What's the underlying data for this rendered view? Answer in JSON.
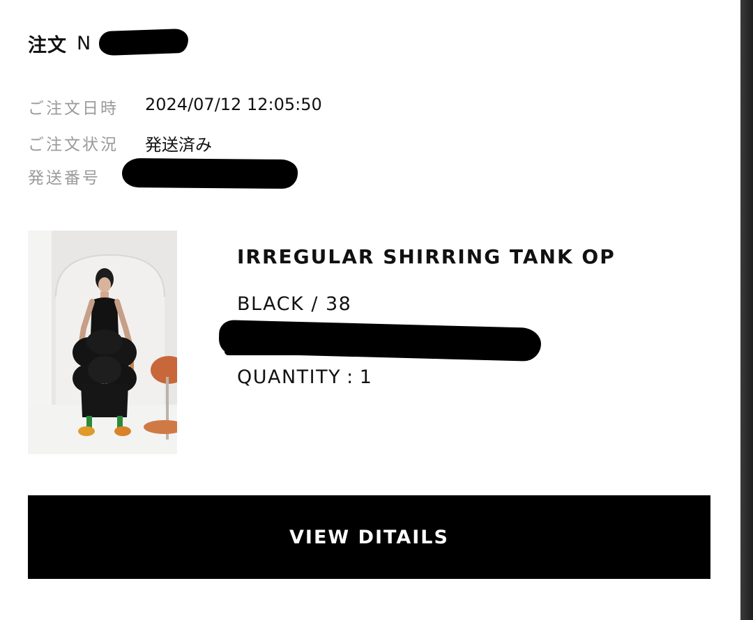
{
  "order": {
    "title_label": "注文",
    "number_visible": "N"
  },
  "meta": [
    {
      "label": "ご注文日時",
      "value": "2024/07/12 12:05:50"
    },
    {
      "label": "ご注文状況",
      "value": "発送済み"
    },
    {
      "label": "発送番号",
      "value": ""
    }
  ],
  "product": {
    "name": "IRREGULAR SHIRRING TANK OP",
    "variant": "BLACK / 38",
    "quantity_label": "QUANTITY",
    "quantity_separator": ":",
    "quantity_value": "1"
  },
  "actions": {
    "details_label": "VIEW DITAILS"
  },
  "colors": {
    "background": "#ffffff",
    "text": "#111111",
    "muted_label": "#9a9a9a",
    "button_bg": "#000000",
    "button_text": "#ffffff"
  }
}
